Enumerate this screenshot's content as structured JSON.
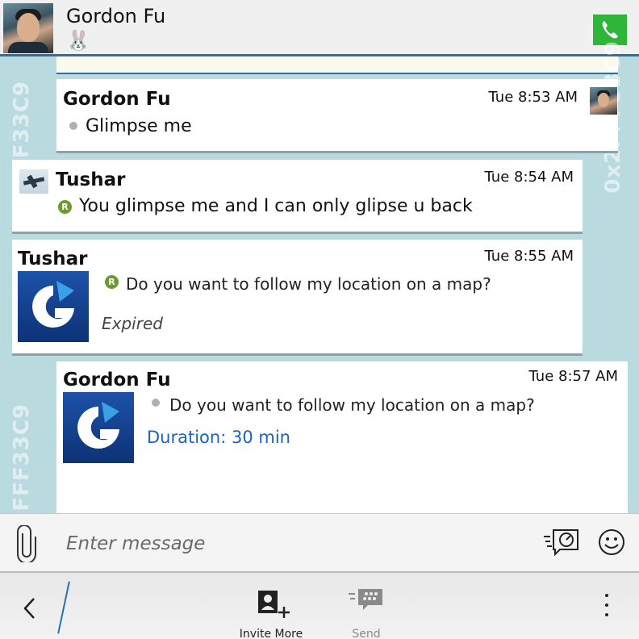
{
  "header": {
    "contact_name": "Gordon Fu",
    "status_icon": "🐰",
    "call_icon": "phone-icon"
  },
  "watermark": "0x2FFF33C9",
  "messages": [
    {
      "sender": "Gordon Fu",
      "time": "Tue 8:53 AM",
      "text": "Glimpse me",
      "marker": "dot"
    },
    {
      "sender": "Tushar",
      "time": "Tue 8:54 AM",
      "text": "You glimpse me and I can only glipse u back",
      "marker": "R"
    },
    {
      "sender": "Tushar",
      "time": "Tue 8:55 AM",
      "text": "Do you want to follow my location on a map?",
      "marker": "R",
      "status": "Expired"
    },
    {
      "sender": "Gordon Fu",
      "time": "Tue 8:57 AM",
      "text": "Do you want to follow my location on a map?",
      "marker": "dot",
      "status": "Duration: 30 min"
    }
  ],
  "composer": {
    "placeholder": "Enter message"
  },
  "actionbar": {
    "invite_label": "Invite More",
    "send_label": "Send"
  }
}
